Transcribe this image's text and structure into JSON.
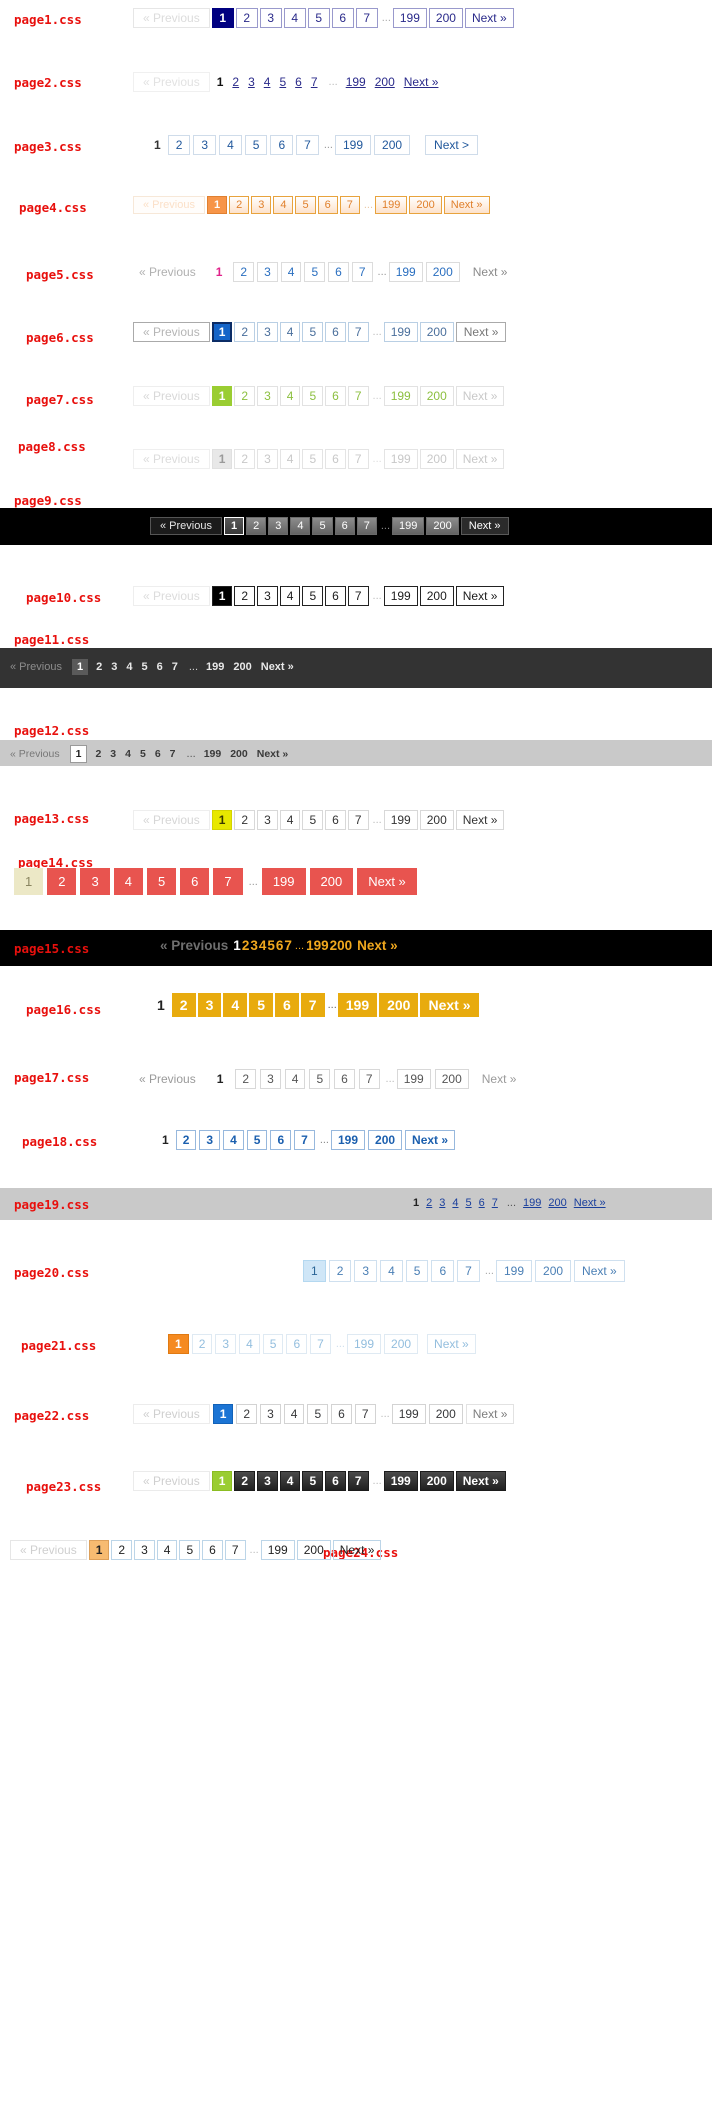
{
  "common": {
    "previous": "« Previous",
    "next": "Next »",
    "next_alt": "Next >",
    "ellipsis": "...",
    "pages": [
      "1",
      "2",
      "3",
      "4",
      "5",
      "6",
      "7"
    ],
    "tail_pages": [
      "199",
      "200"
    ],
    "current_page": "1"
  },
  "colors": {
    "label_red": "#e8100d",
    "navy": "#000080",
    "orange": "#f79548",
    "green": "#9acd32",
    "gold": "#e8ab0e",
    "red_block": "#e8544f",
    "blue": "#1b74d4",
    "yellow": "#e8e800",
    "dark_bar": "#333333",
    "light_bar": "#c9c9c9",
    "black_bar": "#000000"
  },
  "rows": [
    {
      "label": "page1.css",
      "next": "Next »"
    },
    {
      "label": "page2.css",
      "next": "Next »"
    },
    {
      "label": "page3.css",
      "next": "Next >"
    },
    {
      "label": "page4.css",
      "next": "Next »"
    },
    {
      "label": "page5.css",
      "next": "Next »"
    },
    {
      "label": "page6.css",
      "next": "Next »"
    },
    {
      "label": "page7.css",
      "next": "Next »"
    },
    {
      "label": "page8.css",
      "next": "Next »"
    },
    {
      "label": "page9.css",
      "next": "Next »"
    },
    {
      "label": "page10.css",
      "next": "Next »"
    },
    {
      "label": "page11.css",
      "next": "Next »"
    },
    {
      "label": "page12.css",
      "next": "Next »"
    },
    {
      "label": "page13.css",
      "next": "Next »"
    },
    {
      "label": "page14.css",
      "next": "Next »"
    },
    {
      "label": "page15.css",
      "next": "Next »"
    },
    {
      "label": "page16.css",
      "next": "Next »"
    },
    {
      "label": "page17.css",
      "next": "Next »"
    },
    {
      "label": "page18.css",
      "next": "Next »"
    },
    {
      "label": "page19.css",
      "next": "Next »"
    },
    {
      "label": "page20.css",
      "next": "Next »"
    },
    {
      "label": "page21.css",
      "next": "Next »"
    },
    {
      "label": "page22.css",
      "next": "Next »"
    },
    {
      "label": "page23.css",
      "next": "Next »"
    },
    {
      "label": "page24.css",
      "next": "Next »"
    }
  ]
}
